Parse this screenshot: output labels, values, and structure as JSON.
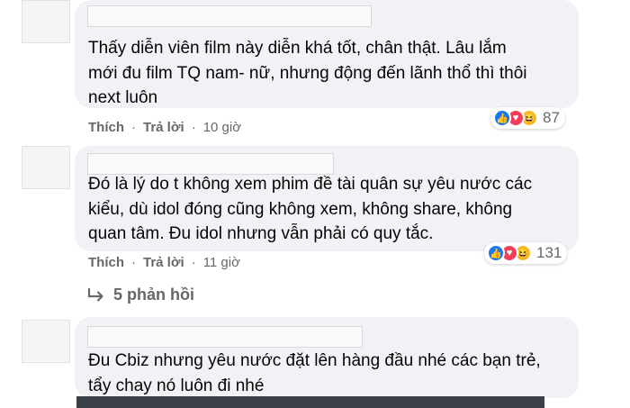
{
  "comments": [
    {
      "text": "Thấy diễn viên film này diễn khá tốt, chân thật. Lâu lắm\nmới đu film TQ nam- nữ, nhưng động đến lãnh thổ thì thôi\nnext luôn",
      "actions": {
        "like": "Thích",
        "reply": "Trả lời",
        "time": "10 giờ"
      },
      "reaction_count": "87"
    },
    {
      "text": "Đó là lý do t không xem phim đề tài quân sự yêu nước các\nkiểu, dù idol đóng cũng không xem, không share, không\nquan tâm. Đu idol nhưng vẫn phải có quy tắc.",
      "actions": {
        "like": "Thích",
        "reply": "Trả lời",
        "time": "11 giờ"
      },
      "reaction_count": "131",
      "replies_label": "5 phản hồi"
    },
    {
      "text": "Đu Cbiz nhưng yêu nước đặt lên hàng đầu nhé các bạn trẻ,\ntẩy chay nó luôn đi nhé"
    }
  ],
  "colors": {
    "bubble": "#f0f2f5",
    "meta_text": "#65676b",
    "like": "#1877f2",
    "love": "#f33e58",
    "haha": "#f7b928"
  }
}
